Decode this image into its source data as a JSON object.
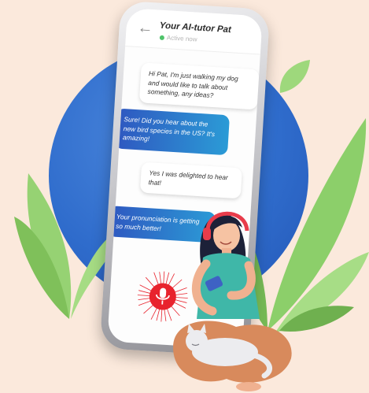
{
  "header": {
    "title": "Your AI-tutor Pat",
    "status": "Active now",
    "back_icon": "back-arrow-icon",
    "status_color": "#4fc36a"
  },
  "messages": [
    {
      "sender": "user",
      "text": "Hi Pat, I'm just walking my dog and would like to talk about something, any ideas?"
    },
    {
      "sender": "bot",
      "text": "Sure! Did you hear about the new bird species in the US? It's amazing!"
    },
    {
      "sender": "user",
      "text": "Yes I was delighted to hear that!"
    },
    {
      "sender": "bot",
      "text": "Your pronunciation is getting so much better!"
    }
  ],
  "mic": {
    "icon": "microphone-icon",
    "color": "#e8232d"
  },
  "colors": {
    "background": "#fbe9dc",
    "circle": "#2f6ccc",
    "bot_bubble_start": "#2f57c0",
    "bot_bubble_end": "#2b9bd6",
    "leaves": "#8ccf6a"
  }
}
